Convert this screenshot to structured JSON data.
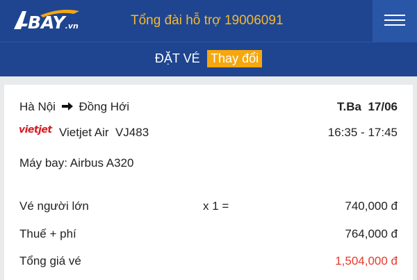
{
  "header": {
    "logo_text": "BAY",
    "logo_suffix": ".vn",
    "hotline": "Tổng đài hỗ trợ 19006091",
    "menu_icon": "hamburger-icon"
  },
  "subheader": {
    "title": "ĐẶT VÉ",
    "change_label": "Thay đổi"
  },
  "flight": {
    "origin": "Hà Nội",
    "destination": "Đồng Hới",
    "day": "T.Ba",
    "date": "17/06",
    "airline_logo": "vietjet",
    "airline": "Vietjet Air",
    "flight_no": "VJ483",
    "time": "16:35 - 17:45",
    "aircraft": "Máy bay: Airbus A320"
  },
  "pricing": {
    "adult_label": "Vé người lớn",
    "adult_qty": "x 1 =",
    "adult_price": "740,000 đ",
    "tax_label": "Thuế + phí",
    "tax_price": "764,000 đ",
    "total_label": "Tổng giá vé",
    "total_price": "1,504,000 đ"
  },
  "colors": {
    "header_bg": "#1f4590",
    "accent": "#f5b82e",
    "change_btn": "#f5a70f",
    "total_price": "#e53a2a"
  }
}
